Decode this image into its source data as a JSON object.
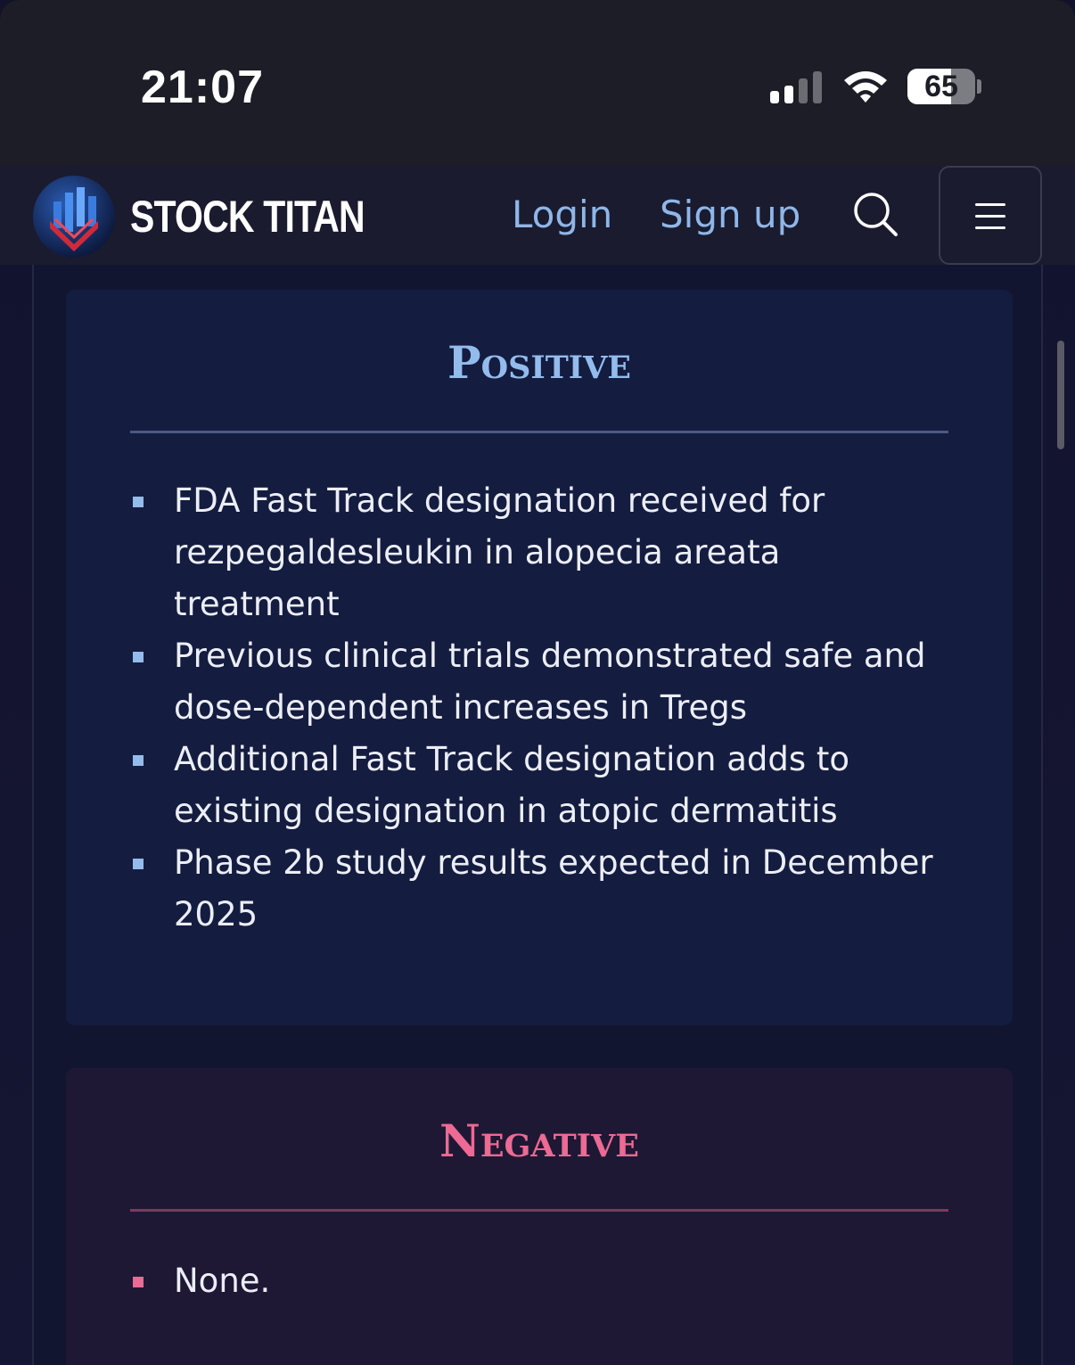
{
  "status_bar": {
    "time": "21:07",
    "battery_percent": "65"
  },
  "navbar": {
    "brand": "STOCK TITAN",
    "login_label": "Login",
    "signup_label": "Sign up",
    "search_icon": "search-icon",
    "menu_icon": "hamburger-menu-icon"
  },
  "positive": {
    "title": "Positive",
    "accent_color": "#93bcec",
    "items": [
      "FDA Fast Track designation received for rezpegaldesleukin in alopecia areata treatment",
      "Previous clinical trials demonstrated safe and dose-dependent increases in Tregs",
      "Additional Fast Track designation adds to existing designation in atopic dermatitis",
      "Phase 2b study results expected in December 2025"
    ]
  },
  "negative": {
    "title": "Negative",
    "accent_color": "#ec6a93",
    "items": [
      "None."
    ]
  }
}
